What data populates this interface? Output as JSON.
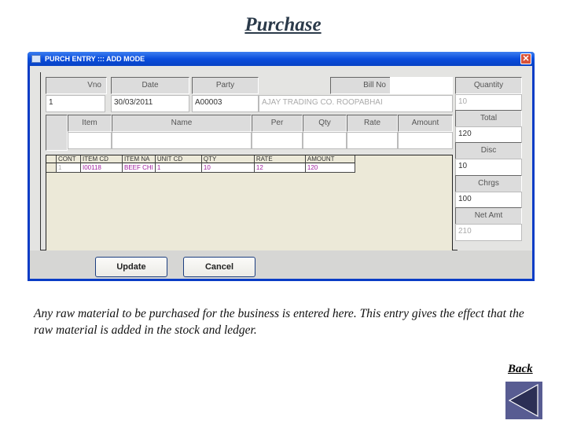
{
  "slide": {
    "title": "Purchase",
    "description": "Any raw material to be purchased for the business is entered here. This entry gives the effect that the raw material is added in the stock and ledger.",
    "back_label": "Back"
  },
  "window": {
    "title": "PURCH ENTRY  :::  ADD MODE",
    "close_glyph": "✕"
  },
  "header_fields": {
    "vno": {
      "label": "Vno",
      "value": "1"
    },
    "date": {
      "label": "Date",
      "value": "30/03/2011"
    },
    "party": {
      "label": "Party",
      "value": "A00003"
    },
    "party_name": {
      "value": "AJAY TRADING CO. ROOPABHAI"
    },
    "bill_no": {
      "label": "Bill No",
      "value": ""
    }
  },
  "item_fields": {
    "headers": [
      "",
      "Item",
      "Name",
      "Per",
      "Qty",
      "Rate",
      "Amount"
    ],
    "values": [
      "",
      "",
      "",
      "",
      "",
      "",
      ""
    ]
  },
  "grid": {
    "columns": [
      "CONT",
      "ITEM CD",
      "ITEM NA",
      "UNIT CD",
      "QTY",
      "RATE",
      "AMOUNT"
    ],
    "rows": [
      [
        "1",
        "I00118",
        "BEEF CHI",
        "1",
        "10",
        "12",
        "120"
      ]
    ]
  },
  "totals": {
    "quantity": {
      "label": "Quantity",
      "value": "10"
    },
    "total": {
      "label": "Total",
      "value": "120"
    },
    "disc": {
      "label": "Disc",
      "value": "10"
    },
    "chrgs": {
      "label": "Chrgs",
      "value": "100"
    },
    "net_amt": {
      "label": "Net Amt",
      "value": "210"
    }
  },
  "buttons": {
    "update": "Update",
    "cancel": "Cancel"
  }
}
